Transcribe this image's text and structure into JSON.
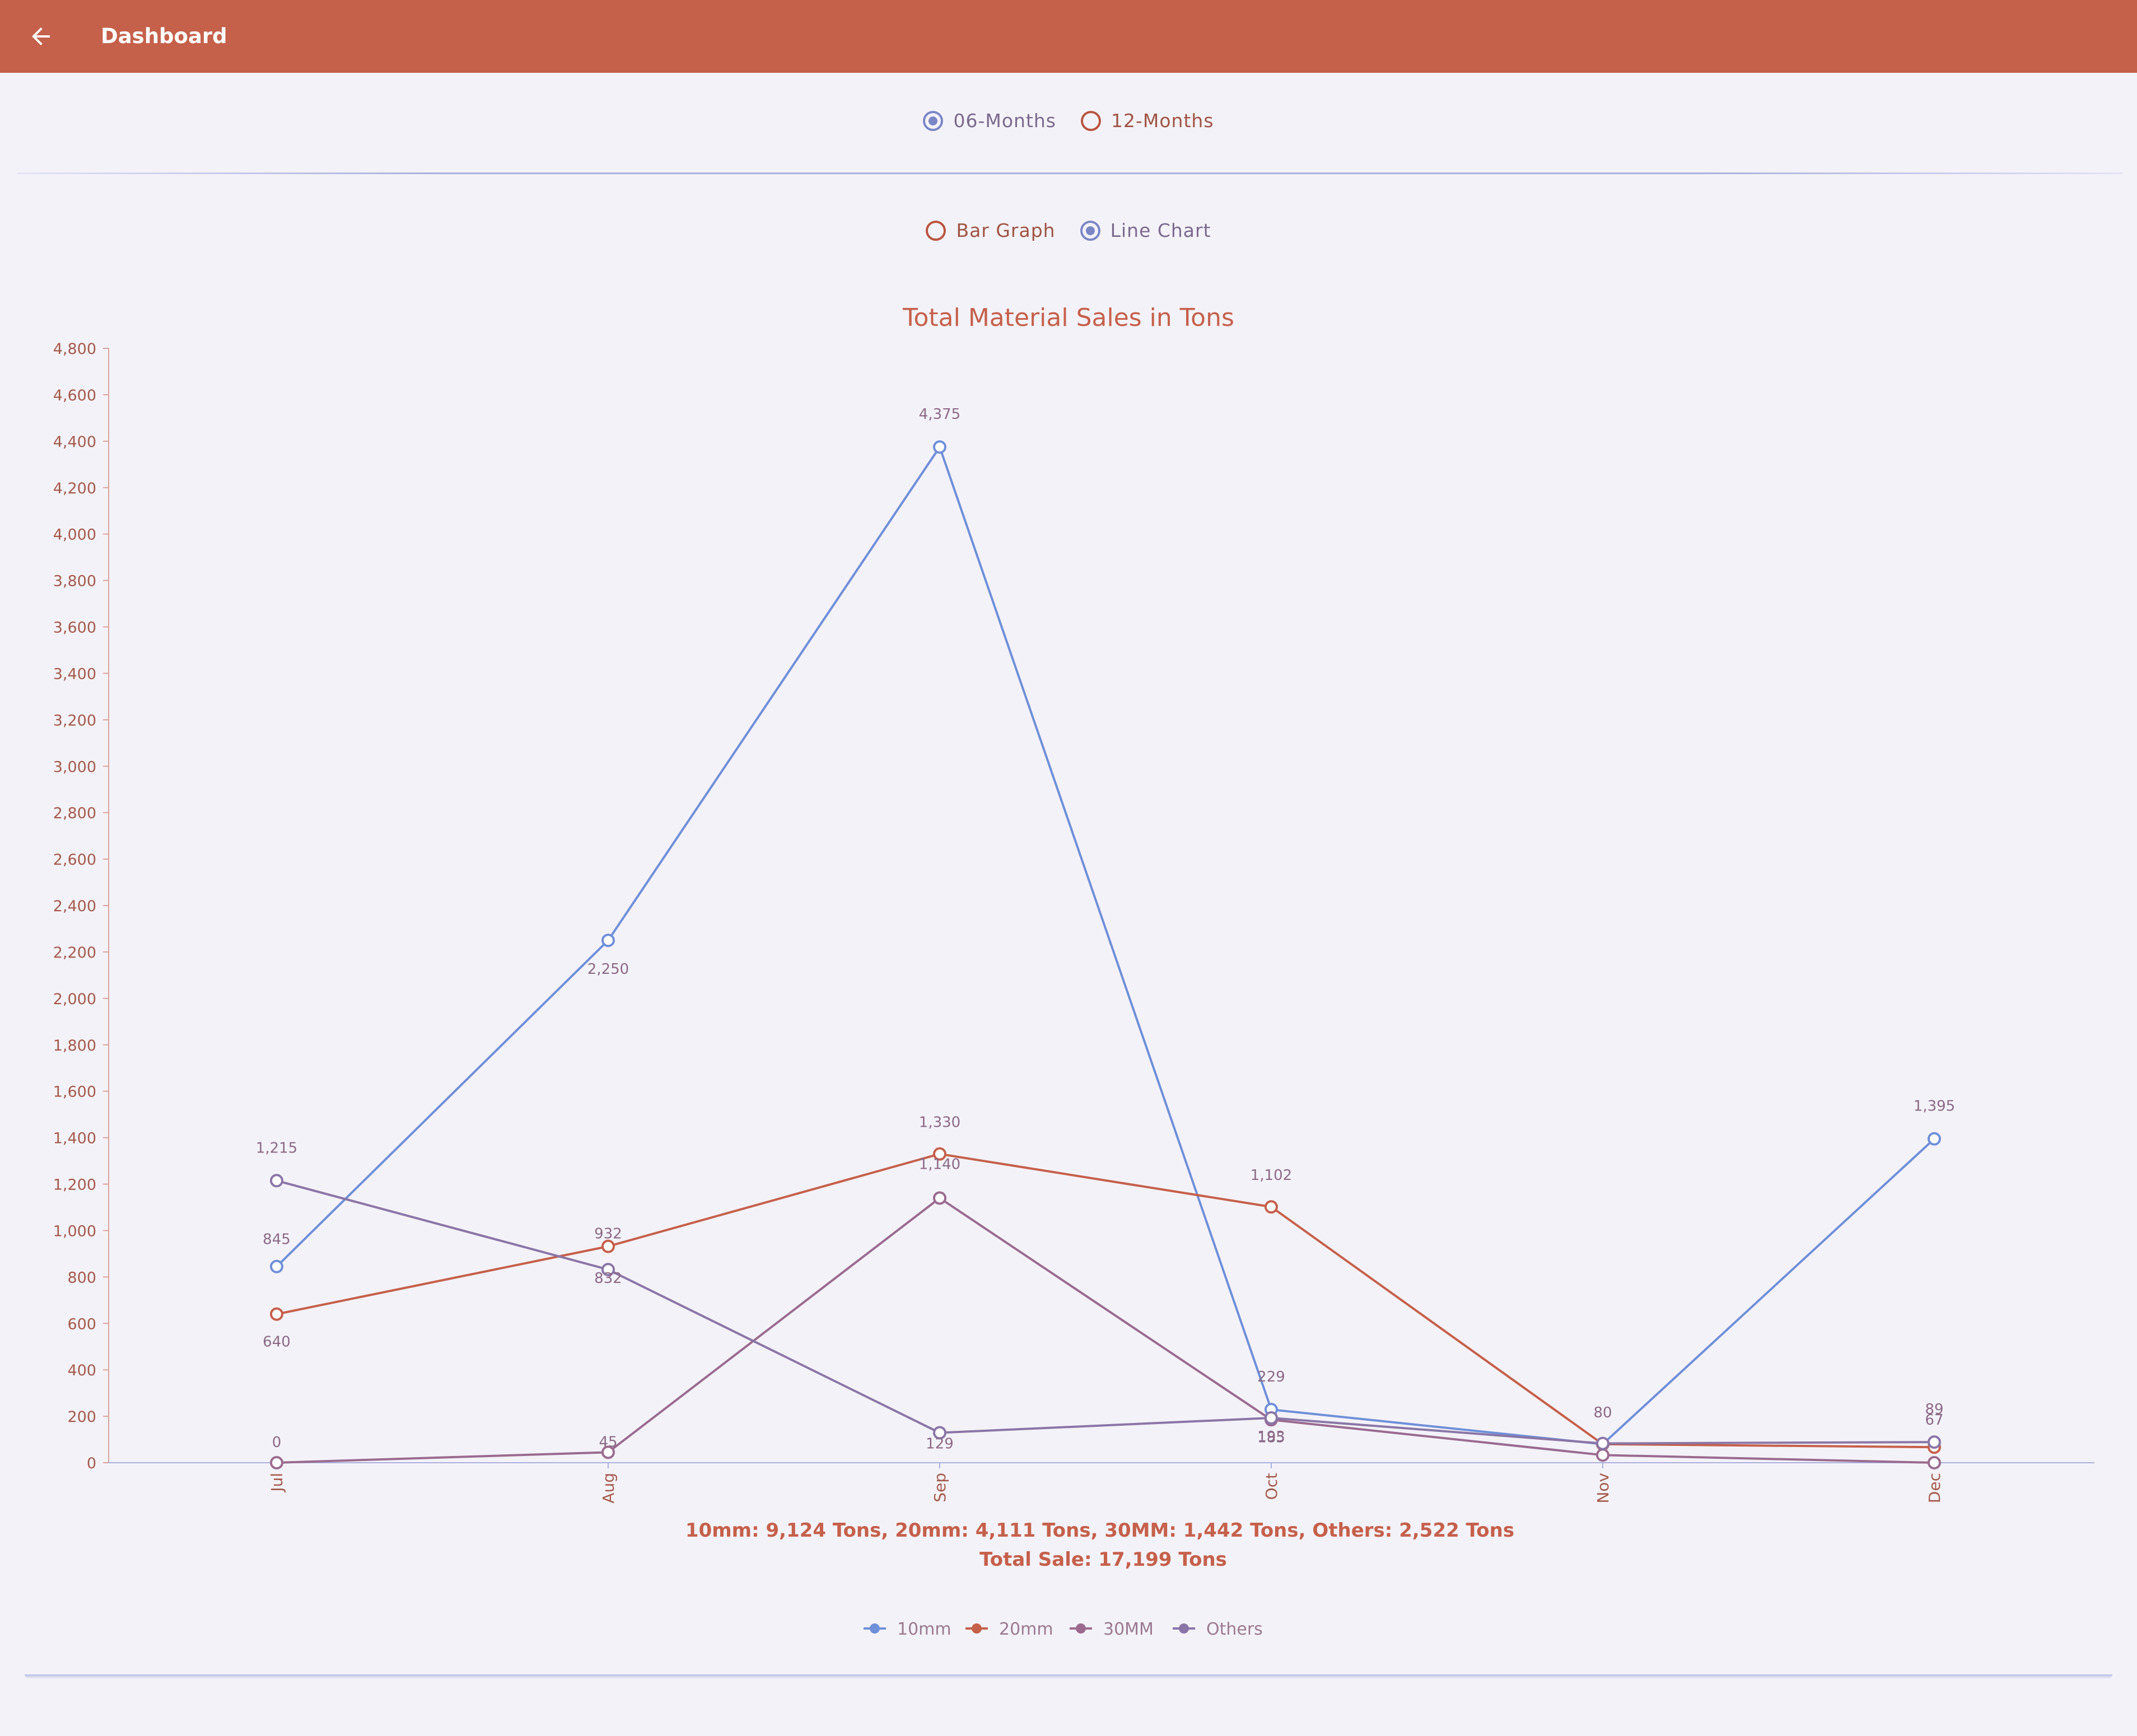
{
  "appbar": {
    "title": "Dashboard",
    "back_icon": "arrow-left-icon"
  },
  "period_selector": {
    "options": [
      {
        "label": "06-Months",
        "selected": true
      },
      {
        "label": "12-Months",
        "selected": false
      }
    ]
  },
  "chart_type_selector": {
    "options": [
      {
        "label": "Bar Graph",
        "selected": false
      },
      {
        "label": "Line Chart",
        "selected": true
      }
    ]
  },
  "colors": {
    "accent": "#c5604a",
    "s10mm": "#6f8fd8",
    "s20mm": "#c5604a",
    "s30mm": "#9a6b8f",
    "others": "#8a76a6"
  },
  "summary": {
    "line1": "10mm: 9,124  Tons, 20mm: 4,111 Tons, 30MM: 1,442 Tons, Others: 2,522 Tons",
    "line2": "Total Sale:  17,199 Tons"
  },
  "chart_data": {
    "type": "line",
    "title": "Total Material Sales in Tons",
    "categories": [
      "Jul",
      "Aug",
      "Sep",
      "Oct",
      "Nov",
      "Dec"
    ],
    "ylim": [
      0,
      4800
    ],
    "yticks": [
      "0",
      "200",
      "400",
      "600",
      "800",
      "1,000",
      "1,200",
      "1,400",
      "1,600",
      "1,800",
      "2,000",
      "2,200",
      "2,400",
      "2,600",
      "2,800",
      "3,000",
      "3,200",
      "3,400",
      "3,600",
      "3,800",
      "4,000",
      "4,200",
      "4,400",
      "4,600",
      "4,800"
    ],
    "legend_position": "bottom",
    "series": [
      {
        "name": "10mm",
        "color": "#6f8fd8",
        "values": [
          845,
          2250,
          4375,
          229,
          80,
          1395
        ],
        "labels": [
          "845",
          "2,250",
          "4,375",
          "229",
          "80",
          "1,395"
        ]
      },
      {
        "name": "20mm",
        "color": "#c5604a",
        "values": [
          640,
          932,
          1330,
          1102,
          80,
          67
        ],
        "labels": [
          "640",
          "932",
          "1,330",
          "1,102",
          "",
          "67"
        ]
      },
      {
        "name": "30MM",
        "color": "#9a6b8f",
        "values": [
          0,
          45,
          1140,
          185,
          33,
          0
        ],
        "labels": [
          "0",
          "45",
          "1,140",
          "185",
          "",
          ""
        ]
      },
      {
        "name": "Others",
        "color": "#8a76a6",
        "values": [
          1215,
          832,
          129,
          193,
          83,
          89
        ],
        "labels": [
          "1,215",
          "832",
          "129",
          "193",
          "",
          "89"
        ]
      }
    ]
  }
}
